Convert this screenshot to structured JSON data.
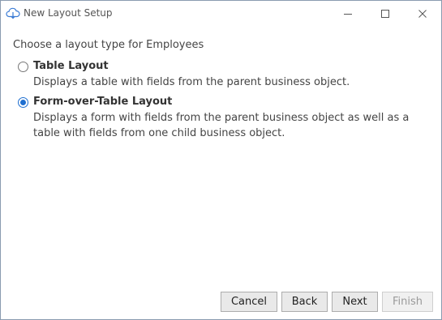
{
  "window": {
    "title": "New Layout Setup",
    "app_icon": "cloud-icon",
    "controls": [
      "minimize-icon",
      "maximize-icon",
      "close-icon"
    ]
  },
  "prompt": "Choose a layout type for Employees",
  "options": [
    {
      "label": "Table Layout",
      "description": "Displays a table with fields from the parent business object.",
      "selected": false
    },
    {
      "label": "Form-over-Table Layout",
      "description": "Displays a form with fields from the parent business object as well as a table with fields from one child business object.",
      "selected": true
    }
  ],
  "buttons": {
    "cancel": "Cancel",
    "back": "Back",
    "next": "Next",
    "finish": "Finish"
  },
  "colors": {
    "accent": "#1f6fd0",
    "disabled_text": "#9a9a9a"
  }
}
